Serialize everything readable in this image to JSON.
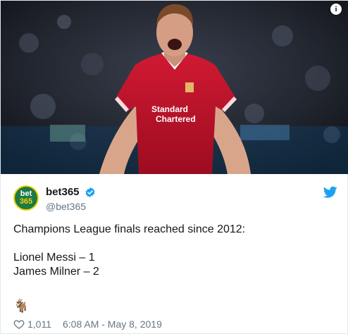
{
  "tweet": {
    "display_name": "bet365",
    "handle": "@bet365",
    "avatar": {
      "line1": "bet",
      "line2": "365"
    },
    "text_lines": [
      "Champions League finals reached since 2012:",
      "",
      "Lionel Messi – 1",
      "James Milner – 2"
    ],
    "emoji": "🐐",
    "likes": "1,011",
    "timestamp": "6:08 AM - May 8, 2019"
  },
  "media": {
    "info_label": "i",
    "jersey_text_line1": "Standard",
    "jersey_text_line2": "Chartered"
  },
  "colors": {
    "brand_green": "#1c7a44",
    "brand_yellow": "#f2d20a",
    "twitter_blue": "#1da1f2",
    "jersey_red": "#c8102e"
  },
  "icons": {
    "verified": "verified-badge-icon",
    "twitter": "twitter-bird-icon",
    "like": "heart-icon",
    "info": "info-icon"
  }
}
